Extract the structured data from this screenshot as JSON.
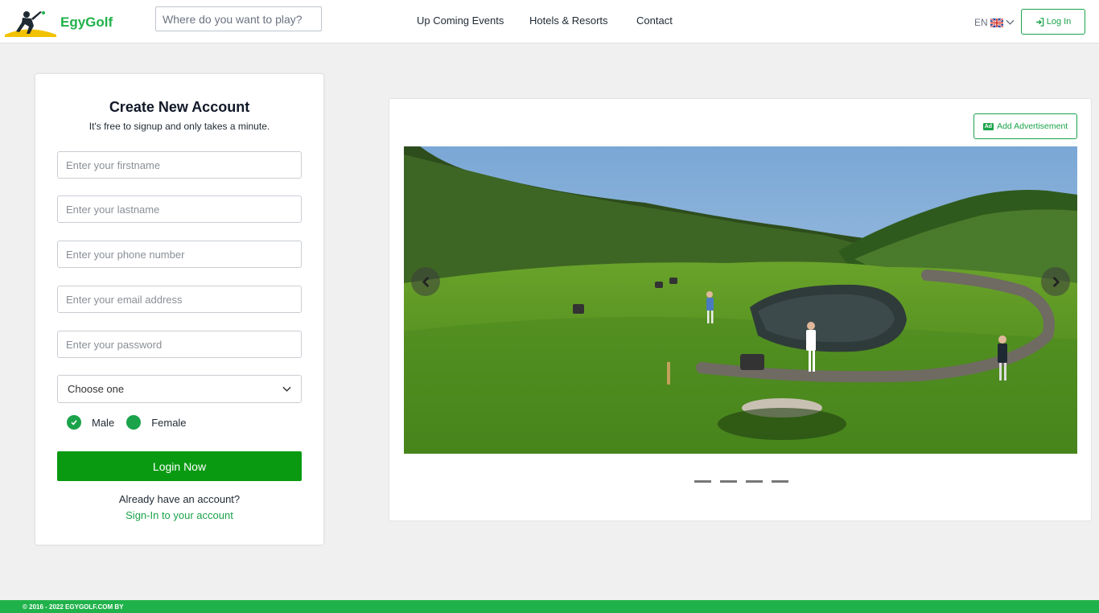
{
  "brand": {
    "name": "EgyGolf",
    "accent": "#20b24a",
    "primary_button": "#0a9a12"
  },
  "header": {
    "search_placeholder": "Where do you want to play?",
    "nav": [
      {
        "label": "Up Coming Events"
      },
      {
        "label": "Hotels & Resorts"
      },
      {
        "label": "Contact"
      }
    ],
    "language": {
      "code": "EN",
      "flag": "uk-flag-icon"
    },
    "login_label": "Log In"
  },
  "signup": {
    "title": "Create New Account",
    "subtitle": "It's free to signup and only takes a minute.",
    "fields": {
      "firstname": "Enter your firstname",
      "lastname": "Enter your lastname",
      "phone": "Enter your phone number",
      "email": "Enter your email address",
      "password": "Enter your password"
    },
    "select_value": "Choose one",
    "gender": {
      "male": "Male",
      "female": "Female",
      "selected": "Male"
    },
    "submit_label": "Login Now",
    "already_text": "Already have an account?",
    "signin_link": "Sign-In to your account"
  },
  "advert": {
    "button_label": "Add Advertisement",
    "button_icon": "Ad",
    "slide_count": 4
  },
  "footer": {
    "text": "© 2016 - 2022 EGYGOLF.COM BY"
  }
}
